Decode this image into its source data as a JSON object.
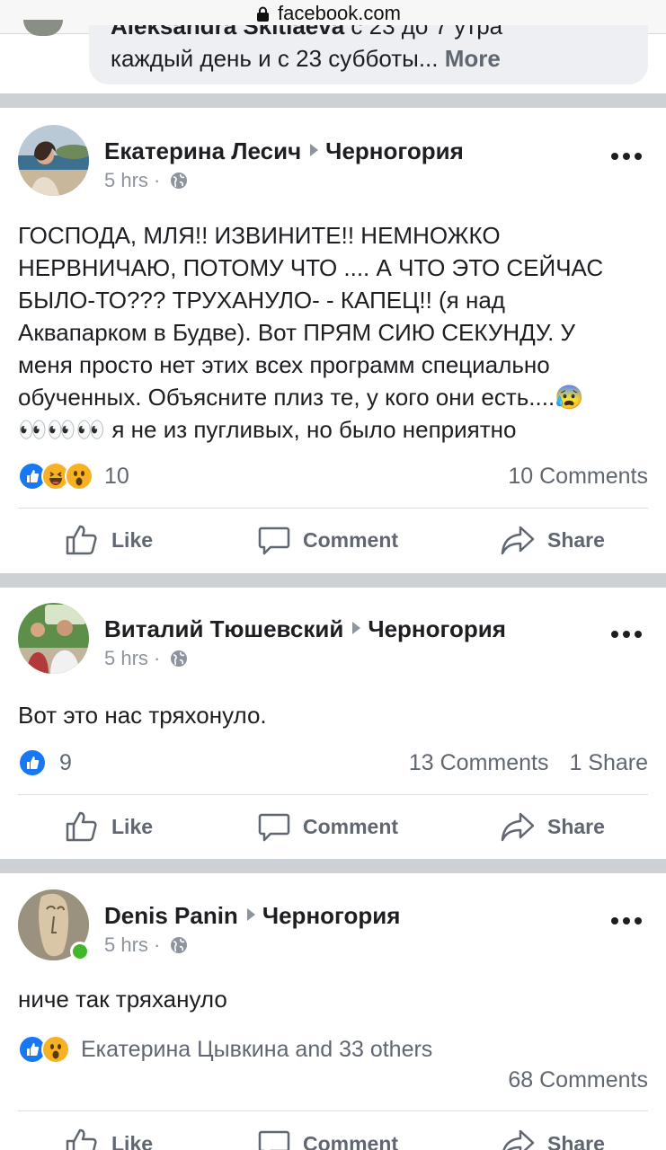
{
  "browser": {
    "url": "facebook.com"
  },
  "top_comment": {
    "author_cut": "Aleksandra Skitlaeva",
    "line1_cut": " с 23 до 7 утра",
    "line2": "каждый день и с 23 субботы...",
    "more": "More"
  },
  "posts": [
    {
      "author": "Екатерина Лесич",
      "group": "Черногория",
      "time": "5 hrs",
      "separator": "·",
      "text_lines": [
        "ГОСПОДА, МЛЯ!! ИЗВИНИТЕ!! НЕМНОЖКО",
        "НЕРВНИЧАЮ, ПОТОМУ ЧТО .... А ЧТО ЭТО СЕЙЧАС",
        "БЫЛО-ТО??? ТРУХАНУЛО- - КАПЕЦ!! (я над",
        "Аквапарком в Будве). Вот ПРЯМ СИЮ СЕКУНДУ. У",
        "меня просто нет этих всех программ специально",
        "обученных. Объясните плиз те, у кого они есть....😰",
        "👀👀👀 я не из пугливых, но было неприятно"
      ],
      "reaction_count": "10",
      "comments": "10 Comments",
      "shares": ""
    },
    {
      "author": "Виталий Тюшевский",
      "group": "Черногория",
      "time": "5 hrs",
      "separator": "·",
      "text_lines": [
        "Вот это нас тряхонуло."
      ],
      "reaction_count": "9",
      "comments": "13 Comments",
      "shares": "1 Share"
    },
    {
      "author": "Denis Panin",
      "group": "Черногория",
      "time": "5 hrs",
      "separator": "·",
      "text_lines": [
        "ниче так тряхануло"
      ],
      "reaction_count": "Екатерина Цывкина and 33 others",
      "comments": "68 Comments",
      "shares": ""
    }
  ],
  "actions": {
    "like": "Like",
    "comment": "Comment",
    "share": "Share"
  },
  "colors": {
    "divider": "#cdd0d5",
    "like_blue": "#1877f2",
    "online_green": "#42b72a",
    "muted": "#606770"
  },
  "icons": [
    "lock-icon",
    "globe-icon",
    "more-dots-icon",
    "like-icon",
    "comment-icon",
    "share-icon",
    "like-reaction-icon",
    "haha-reaction-icon",
    "wow-reaction-icon"
  ]
}
